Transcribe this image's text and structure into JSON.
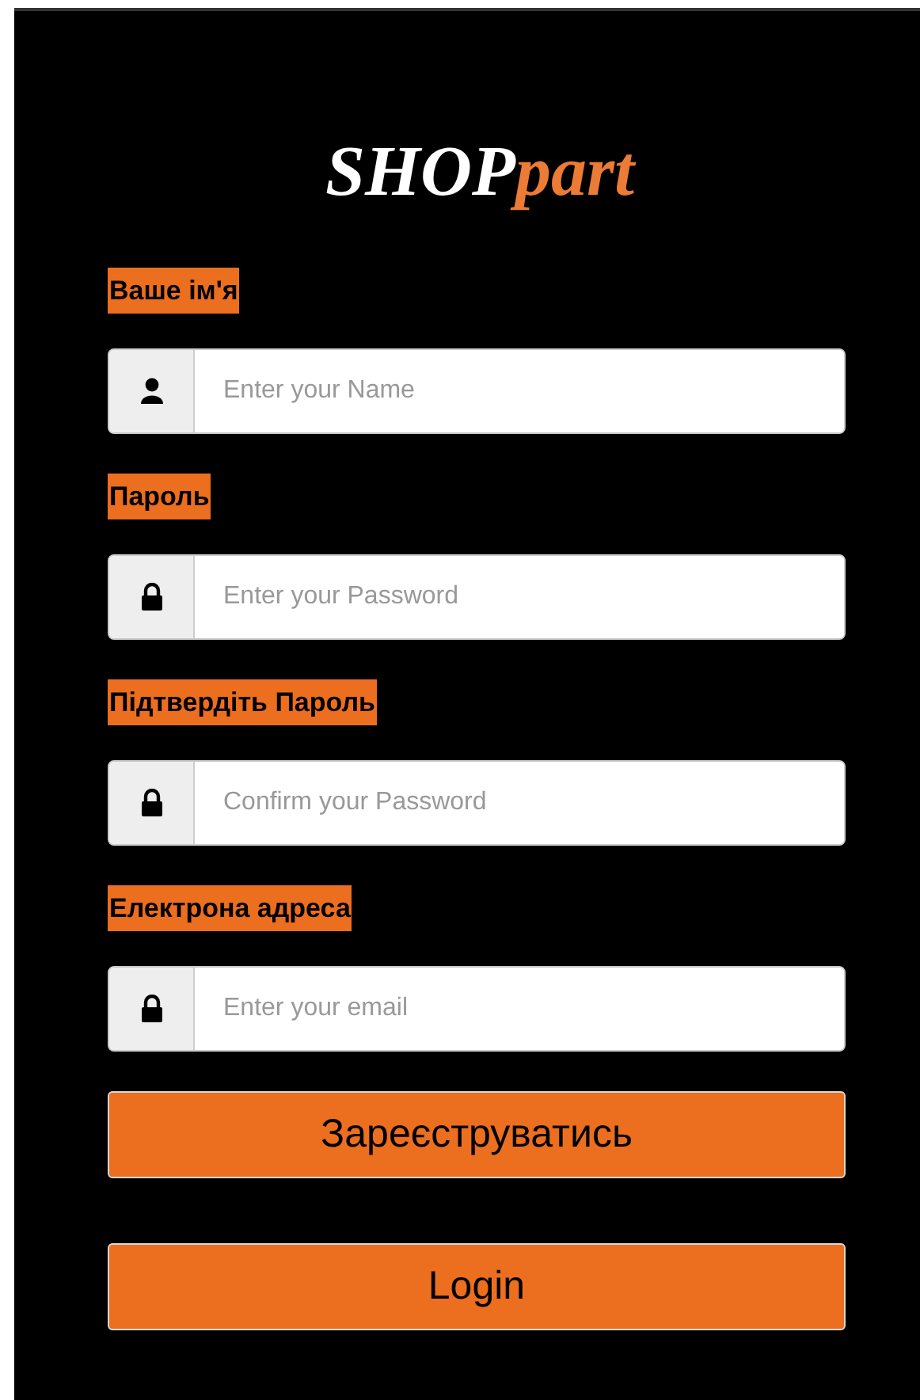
{
  "logo": {
    "primary": "SHOP",
    "accent": "part"
  },
  "fields": [
    {
      "label": "Ваше ім'я",
      "kind": "user",
      "placeholder": "Enter your Name"
    },
    {
      "label": "Пароль",
      "kind": "lock",
      "placeholder": "Enter your Password"
    },
    {
      "label": "Підтвердіть Пароль",
      "kind": "lock",
      "placeholder": "Confirm your Password"
    },
    {
      "label": "Електрона адреса",
      "kind": "lock",
      "placeholder": "Enter your email"
    }
  ],
  "buttons": [
    "Зареєструватись",
    "Login"
  ]
}
